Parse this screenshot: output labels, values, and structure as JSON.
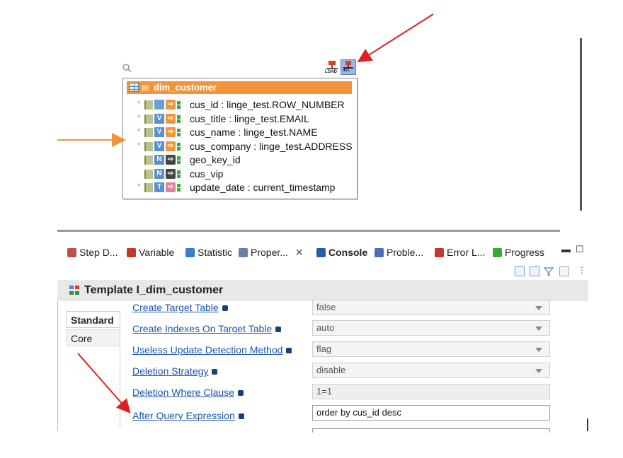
{
  "diagram": {
    "table_title": "dim_customer",
    "rows": [
      {
        "text": "cus_id : linge_test.ROW_NUMBER",
        "required": true,
        "type_badge": "",
        "badge_color": "#6aa0d8",
        "map_color": "#f0953a"
      },
      {
        "text": "cus_title : linge_test.EMAIL",
        "required": true,
        "type_badge": "V",
        "badge_color": "#5b8fd0",
        "map_color": "#f0953a"
      },
      {
        "text": "cus_name : linge_test.NAME",
        "required": true,
        "type_badge": "V",
        "badge_color": "#5b8fd0",
        "map_color": "#f0953a"
      },
      {
        "text": "cus_company : linge_test.ADDRESS",
        "required": true,
        "type_badge": "V",
        "badge_color": "#5b8fd0",
        "map_color": "#f0953a"
      },
      {
        "text": "geo_key_id",
        "required": false,
        "type_badge": "N",
        "badge_color": "#5b8fd0",
        "map_color": "#444444"
      },
      {
        "text": "cus_vip",
        "required": false,
        "type_badge": "N",
        "badge_color": "#5b8fd0",
        "map_color": "#444444"
      },
      {
        "text": "update_date : current_timestamp",
        "required": true,
        "type_badge": "T",
        "badge_color": "#5b8fd0",
        "map_color": "#e080a0"
      }
    ],
    "required_marker": "*",
    "load_label": "LOAD",
    "int_label": "INT."
  },
  "tabs": [
    {
      "label": "Step D...",
      "icon": "step-icon",
      "color": "#c0504d"
    },
    {
      "label": "Variable",
      "icon": "variable-icon",
      "color": "#c0392b"
    },
    {
      "label": "Statistic",
      "icon": "statistic-icon",
      "color": "#3a7bd5"
    },
    {
      "label": "Proper...",
      "icon": "properties-icon",
      "color": "#6b7fa8"
    },
    {
      "label": "Console",
      "icon": "console-icon",
      "color": "#2b5ca8"
    },
    {
      "label": "Proble...",
      "icon": "problems-icon",
      "color": "#4b70b8"
    },
    {
      "label": "Error L...",
      "icon": "error-log-icon",
      "color": "#c0392b"
    },
    {
      "label": "Progress",
      "icon": "progress-icon",
      "color": "#3aa83a"
    }
  ],
  "close_glyph": "✕",
  "template_title": "Template I_dim_customer",
  "side_tabs": [
    "Standard",
    "Core"
  ],
  "properties": [
    {
      "label": "Create Target Table",
      "value": "false",
      "kind": "select"
    },
    {
      "label": "Create Indexes On Target Table",
      "value": "auto",
      "kind": "select"
    },
    {
      "label": "Useless Update Detection Method",
      "value": "flag",
      "kind": "select"
    },
    {
      "label": "Deletion Strategy",
      "value": "disable",
      "kind": "select"
    },
    {
      "label": "Deletion Where Clause",
      "value": "1=1",
      "kind": "readonly"
    },
    {
      "label": "After Query Expression",
      "value": "order by cus_id desc",
      "kind": "edit"
    }
  ],
  "colors": {
    "annotation_red": "#e02020",
    "annotation_orange": "#f0953a",
    "link": "#1a55b0"
  }
}
